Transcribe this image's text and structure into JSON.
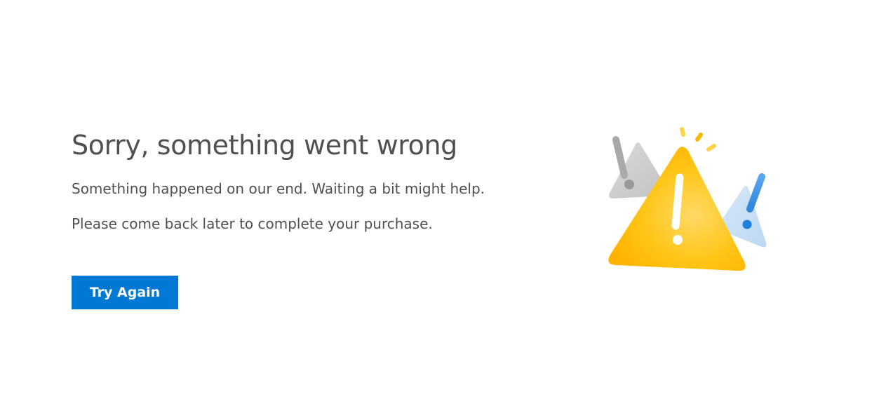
{
  "error": {
    "title": "Sorry, something went wrong",
    "message_line1": "Something happened on our end. Waiting a bit might help.",
    "message_line2": "Please come back later to complete your purchase.",
    "retry_label": "Try Again"
  },
  "illustration": {
    "icon": "warning-icon",
    "colors": {
      "warning": "#ffb900",
      "accent_blue": "#0078d4",
      "neutral_gray": "#c8c8c8"
    }
  },
  "theme": {
    "text_color": "#505050",
    "button_background": "#0078d4",
    "button_text": "#ffffff",
    "background": "#ffffff"
  }
}
